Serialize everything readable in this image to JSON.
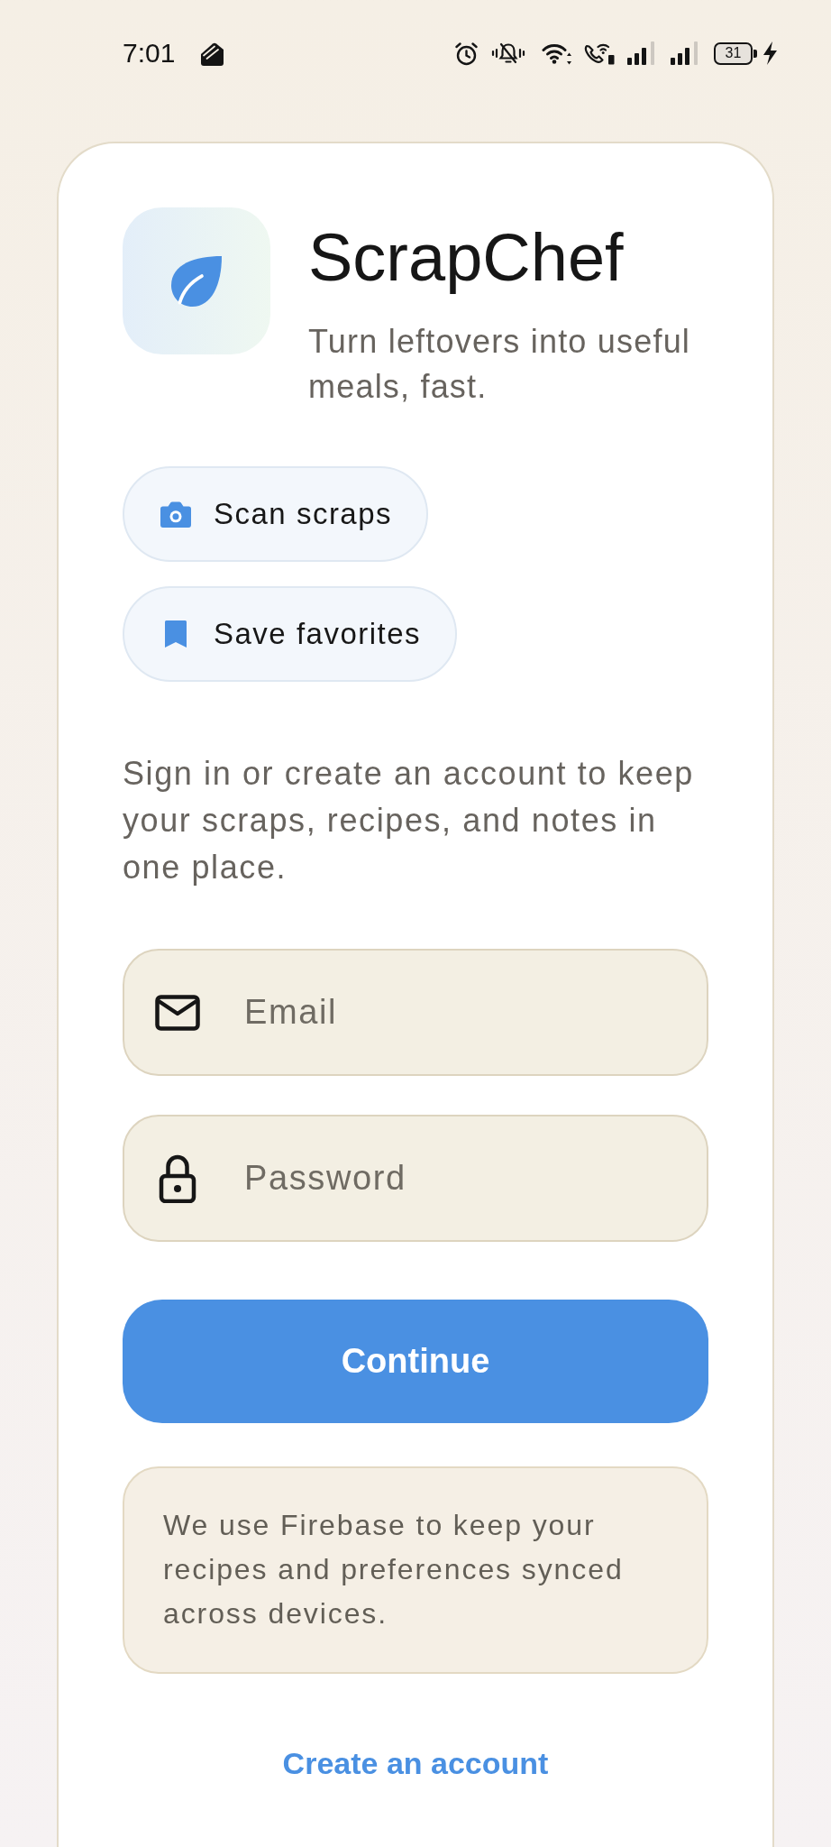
{
  "status_bar": {
    "time": "7:01",
    "battery": "31"
  },
  "header": {
    "title": "ScrapChef",
    "tagline": "Turn leftovers into useful meals, fast."
  },
  "features": [
    {
      "kind": "camera",
      "label": "Scan scraps"
    },
    {
      "kind": "bookmark",
      "label": "Save favorites"
    }
  ],
  "intro": "Sign in or create an account to keep your scraps, recipes, and notes in one place.",
  "fields": [
    {
      "kind": "email",
      "placeholder": "Email"
    },
    {
      "kind": "password",
      "placeholder": "Password"
    }
  ],
  "continue_button": "Continue",
  "notice": "We use Firebase to keep your recipes and preferences synced across devices.",
  "create_account_link": "Create an account"
}
